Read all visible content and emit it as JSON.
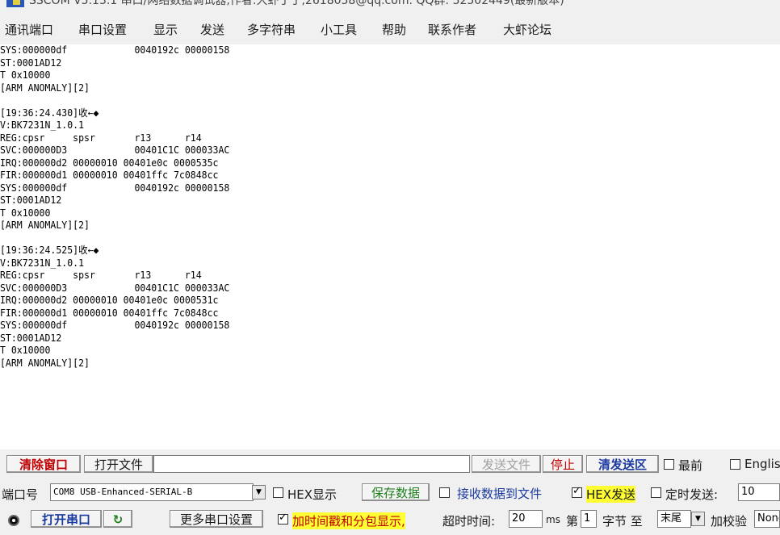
{
  "window": {
    "title": "SSCOM V5.13.1 串口/网络数据调试器,作者:大虾丁丁,2618058@qq.com. QQ群: 52502449(最新版本)"
  },
  "menu": [
    "通讯端口",
    "串口设置",
    "显示",
    "发送",
    "多字符串",
    "小工具",
    "帮助",
    "联系作者",
    "大虾论坛"
  ],
  "receive_log": "SYS:000000df            0040192c 00000158\nST:0001AD12\nT 0x10000\n[ARM ANOMALY][2]\n\n[19:36:24.430]收←◆\nV:BK7231N_1.0.1\nREG:cpsr     spsr       r13      r14\nSVC:000000D3            00401C1C 000033AC\nIRQ:000000d2 00000010 00401e0c 0000535c\nFIR:000000d1 00000010 00401ffc 7c0848cc\nSYS:000000df            0040192c 00000158\nST:0001AD12\nT 0x10000\n[ARM ANOMALY][2]\n\n[19:36:24.525]收←◆\nV:BK7231N_1.0.1\nREG:cpsr     spsr       r13      r14\nSVC:000000D3            00401C1C 000033AC\nIRQ:000000d2 00000010 00401e0c 0000531c\nFIR:000000d1 00000010 00401ffc 7c0848cc\nSYS:000000df            0040192c 00000158\nST:0001AD12\nT 0x10000\n[ARM ANOMALY][2]",
  "toolbar1": {
    "clear_window": "清除窗口",
    "open_file": "打开文件",
    "file_path": "",
    "send_file": "发送文件",
    "stop": "停止",
    "clear_send": "清发送区",
    "topmost": "最前",
    "english": "English"
  },
  "toolbar2": {
    "port_label": "端口号",
    "port_value": "COM8 USB-Enhanced-SERIAL-B",
    "hex_display": "HEX显示",
    "save_data": "保存数据",
    "recv_to_file": "接收数据到文件",
    "hex_send": "HEX发送",
    "timed_send": "定时发送:",
    "timed_value": "10"
  },
  "toolbar3": {
    "open_port": "打开串口",
    "more_settings": "更多串口设置",
    "timestamp": "加时间戳和分包显示,",
    "timeout_label": "超时时间:",
    "timeout_value": "20",
    "ms": "ms",
    "nth": "第",
    "byte_value": "1",
    "byte_to": "字节 至",
    "end_value": "末尾",
    "checksum": "加校验",
    "checksum_value": "None"
  },
  "states": {
    "hex_display": false,
    "recv_to_file": false,
    "hex_send": true,
    "timed_send": false,
    "topmost": false,
    "english": false,
    "timestamp": true
  },
  "colors": {
    "clear_red": "#c00000",
    "highlight_yellow": "#ffff33",
    "link_blue": "#1a3aa0",
    "save_green": "#208020"
  }
}
